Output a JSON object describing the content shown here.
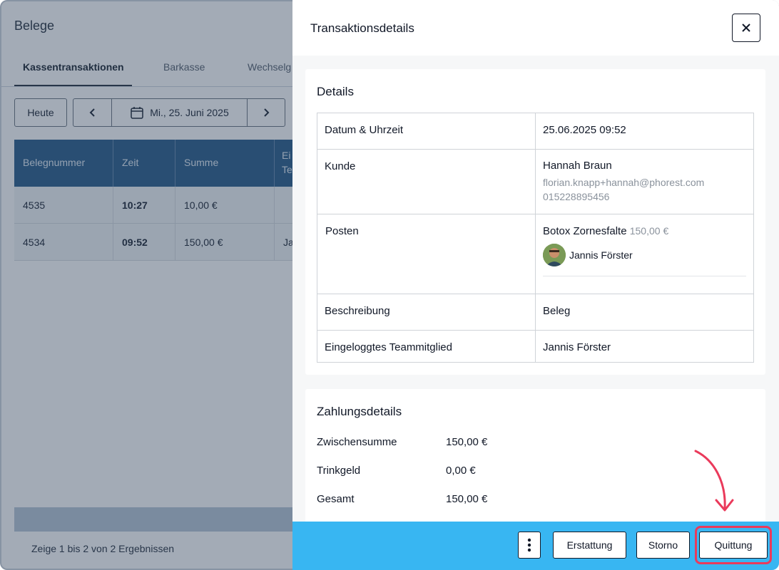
{
  "background": {
    "page_title": "Belege",
    "tabs": [
      "Kassentransaktionen",
      "Barkasse",
      "Wechselg"
    ],
    "today_button": "Heute",
    "date_label": "Mi., 25. Juni 2025",
    "table_headers": [
      "Belegnummer",
      "Zeit",
      "Summe",
      "Ei\nTe"
    ],
    "rows": [
      {
        "number": "4535",
        "time": "10:27",
        "sum": "10,00 €",
        "extra": ""
      },
      {
        "number": "4534",
        "time": "09:52",
        "sum": "150,00 €",
        "extra": "Ja"
      }
    ],
    "footer_text": "Zeige 1 bis 2 von 2 Ergebnissen"
  },
  "drawer": {
    "title": "Transaktionsdetails",
    "details": {
      "heading": "Details",
      "date_label": "Datum & Uhrzeit",
      "date_value": "25.06.2025 09:52",
      "customer_label": "Kunde",
      "customer_name": "Hannah Braun",
      "customer_email": "florian.knapp+hannah@phorest.com",
      "customer_phone": "015228895456",
      "items_label": "Posten",
      "item_name": "Botox Zornesfalte",
      "item_price": "150,00 €",
      "item_staff": "Jannis Förster",
      "description_label": "Beschreibung",
      "description_value": "Beleg",
      "logged_in_label": "Eingeloggtes Teammitglied",
      "logged_in_value": "Jannis Förster"
    },
    "payment": {
      "heading": "Zahlungsdetails",
      "subtotal_label": "Zwischensumme",
      "subtotal_value": "150,00 €",
      "tip_label": "Trinkgeld",
      "tip_value": "0,00 €",
      "total_label": "Gesamt",
      "total_value": "150,00 €"
    },
    "actions": {
      "refund": "Erstattung",
      "cancel": "Storno",
      "receipt": "Quittung"
    }
  },
  "colors": {
    "action_bar": "#38b6f2",
    "highlight": "#ea3a5b",
    "table_header": "#2d5f8c"
  }
}
